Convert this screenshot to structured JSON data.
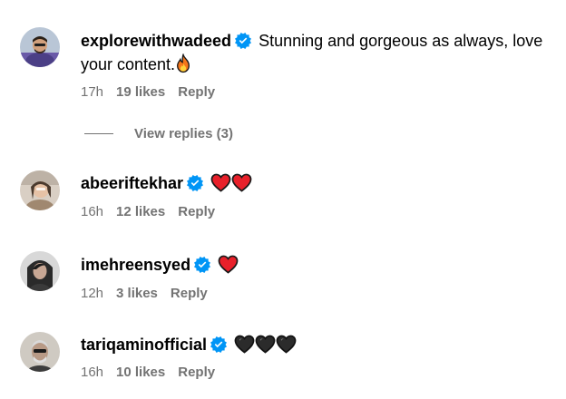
{
  "comments": [
    {
      "username": "explorewithwadeed",
      "text": "Stunning and gorgeous as always, love your content.",
      "emoji": [
        "fire"
      ],
      "time": "17h",
      "likes": "19 likes",
      "reply": "Reply",
      "view_replies": "View replies (3)"
    },
    {
      "username": "abeeriftekhar",
      "text": "",
      "emoji": [
        "red-heart",
        "red-heart"
      ],
      "time": "16h",
      "likes": "12 likes",
      "reply": "Reply"
    },
    {
      "username": "imehreensyed",
      "text": "",
      "emoji": [
        "red-heart"
      ],
      "time": "12h",
      "likes": "3 likes",
      "reply": "Reply"
    },
    {
      "username": "tariqaminofficial",
      "text": "",
      "emoji": [
        "black-heart",
        "black-heart",
        "black-heart"
      ],
      "time": "16h",
      "likes": "10 likes",
      "reply": "Reply"
    }
  ],
  "colors": {
    "verified_badge": "#0095f6",
    "meta_text": "#737373",
    "red_heart": "#e8202a",
    "black_heart": "#2b2b2b",
    "fire": "#f5761a"
  }
}
